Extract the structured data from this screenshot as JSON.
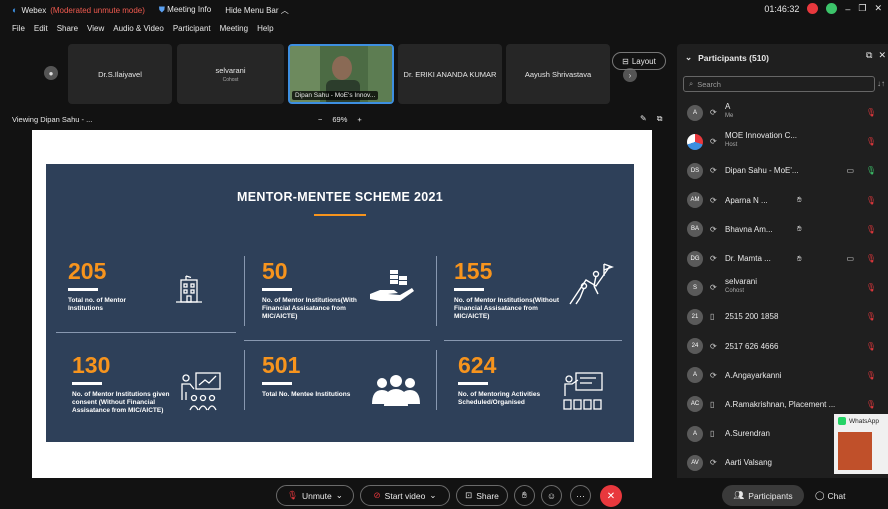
{
  "titlebar": {
    "app_name": "Webex",
    "moderated": "(Moderated unmute mode)",
    "meeting_info": "Meeting Info",
    "hide_menu": "Hide Menu Bar",
    "clock": "01:46:32",
    "minimize": "–",
    "restore": "❐",
    "close": "✕"
  },
  "menu": [
    "File",
    "Edit",
    "Share",
    "View",
    "Audio & Video",
    "Participant",
    "Meeting",
    "Help"
  ],
  "strip": {
    "tiles": [
      {
        "name": "Dr.S.Ilaiyavel",
        "sub": ""
      },
      {
        "name": "selvarani",
        "sub": "Cohost"
      },
      {
        "name": "Dr. ERIKI ANANDA KUMAR",
        "sub": ""
      },
      {
        "name": "Aayush Shrivastava",
        "sub": ""
      }
    ],
    "active_label": "Dipan Sahu - MoE's Innov...",
    "layout_label": "Layout"
  },
  "viewbar": {
    "viewing": "Viewing Dipan Sahu - ...",
    "zoom_minus": "−",
    "zoom": "69%",
    "zoom_plus": "+"
  },
  "slide": {
    "title": "MENTOR-MENTEE SCHEME 2021",
    "stats": [
      {
        "num": "205",
        "desc": "Total no. of Mentor Institutions"
      },
      {
        "num": "50",
        "desc": "No. of Mentor Institutions(With Financial Assisatance from MIC/AICTE)"
      },
      {
        "num": "155",
        "desc": "No. of Mentor Institutions(Without Financial Assisatance from MIC/AICTE)"
      },
      {
        "num": "130",
        "desc": "No. of Mentor Institutions given consent (Without Financial Assisatance from MIC/AICTE)"
      },
      {
        "num": "501",
        "desc": "Total No. Mentee Institutions"
      },
      {
        "num": "624",
        "desc": "No. of Mentoring Activities Scheduled/Organised"
      }
    ]
  },
  "panel": {
    "title": "Participants (510)",
    "search_placeholder": "Search",
    "participants": [
      {
        "initials": "A",
        "name": "A",
        "role": "Me",
        "device": "⟳"
      },
      {
        "initials": "",
        "name": "MOE Innovation C...",
        "role": "Host",
        "device": "⟳"
      },
      {
        "initials": "DS",
        "name": "Dipan Sahu - MoE'...",
        "role": "",
        "device": "⟳"
      },
      {
        "initials": "AM",
        "name": "Aparna N ...",
        "role": "",
        "device": "⟳"
      },
      {
        "initials": "BA",
        "name": "Bhavna Am...",
        "role": "",
        "device": "⟳"
      },
      {
        "initials": "DG",
        "name": "Dr. Mamta ...",
        "role": "",
        "device": "⟳"
      },
      {
        "initials": "S",
        "name": "selvarani",
        "role": "Cohost",
        "device": "⟳"
      },
      {
        "initials": "21",
        "name": "2515 200 1858",
        "role": "",
        "device": "▯"
      },
      {
        "initials": "24",
        "name": "2517 626 4666",
        "role": "",
        "device": "⟳"
      },
      {
        "initials": "A",
        "name": "A.Angayarkanni",
        "role": "",
        "device": "⟳"
      },
      {
        "initials": "AC",
        "name": "A.Ramakrishnan, Placement ...",
        "role": "",
        "device": "▯"
      },
      {
        "initials": "A",
        "name": "A.Surendran",
        "role": "",
        "device": "▯"
      },
      {
        "initials": "AV",
        "name": "Aarti Valsang",
        "role": "",
        "device": "⟳"
      }
    ]
  },
  "toolbar": {
    "unmute": "Unmute",
    "start_video": "Start video",
    "share": "Share",
    "participants": "Participants",
    "chat": "Chat"
  },
  "whatsapp": {
    "title": "WhatsApp"
  },
  "colors": {
    "accent_orange": "#f7941d",
    "slide_bg": "#2e4059",
    "end_red": "#e8383d",
    "muted_red": "#e8383d"
  }
}
